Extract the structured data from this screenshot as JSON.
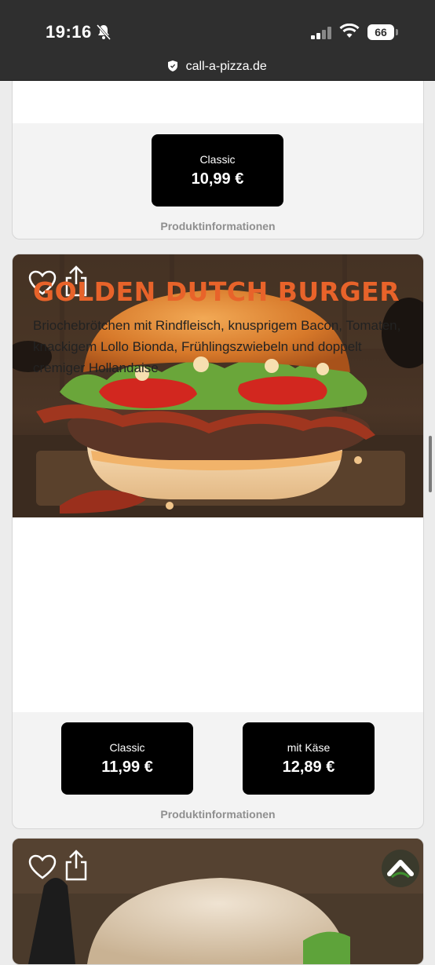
{
  "status_bar": {
    "time": "19:16",
    "battery": "66",
    "url": "call-a-pizza.de"
  },
  "items": [
    {
      "variants": [
        {
          "label": "Classic",
          "price": "10,99 €"
        }
      ],
      "info_link": "Produktinformationen"
    },
    {
      "title": "GOLDEN DUTCH BURGER",
      "description": "Briochebrötchen mit Rindfleisch, knusprigem Bacon, Tomaten, knackigem Lollo Bionda, Frühlingszwiebeln und doppelt cremiger Hollandaise",
      "variants": [
        {
          "label": "Classic",
          "price": "11,99 €"
        },
        {
          "label": "mit Käse",
          "price": "12,89 €"
        }
      ],
      "info_link": "Produktinformationen"
    }
  ],
  "colors": {
    "title_orange": "#e8632a",
    "button_black": "#000000",
    "status_bar": "#2f2f2f"
  },
  "icons": [
    "bell-slash-icon",
    "signal-icon",
    "wifi-icon",
    "heart-icon",
    "share-icon",
    "shield-icon",
    "arrow-up-icon"
  ]
}
